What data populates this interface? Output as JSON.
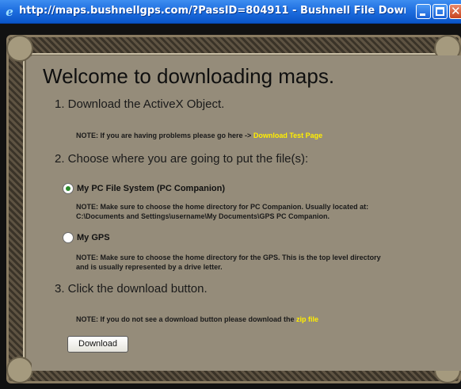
{
  "window": {
    "title": "http://maps.bushnellgps.com/?PassID=804911 - Bushnell File Download - W...",
    "browser_icon": "ie-icon",
    "controls": {
      "minimize": "minimize-icon",
      "maximize": "maximize-icon",
      "close": "close-icon"
    }
  },
  "page": {
    "heading": "Welcome to downloading maps.",
    "step1": {
      "title": "1. Download the ActiveX Object.",
      "note_prefix": "NOTE: If you are having problems please go here ->",
      "link": "Download Test Page"
    },
    "step2": {
      "title": "2. Choose where you are going to put the file(s):",
      "option1": {
        "label": "My PC File System (PC Companion)",
        "selected": true,
        "note_line1": "NOTE: Make sure to choose the home directory for PC Companion. Usually located at:",
        "note_line2": "C:\\Documents and Settings\\username\\My Documents\\GPS PC Companion."
      },
      "option2": {
        "label": "My GPS",
        "selected": false,
        "note_line1": "NOTE: Make sure to choose the home directory for the GPS. This is the top level directory",
        "note_line2": "and is usually represented by a drive letter."
      }
    },
    "step3": {
      "title": "3. Click the download button.",
      "note_prefix": "NOTE: If you do not see a download button please download the",
      "link": "zip file"
    },
    "download_button": "Download"
  },
  "colors": {
    "title_bar": "#1f6fe0",
    "panel": "#958c7a",
    "link": "#ffee00",
    "radio_selected": "#2a8a2a"
  }
}
